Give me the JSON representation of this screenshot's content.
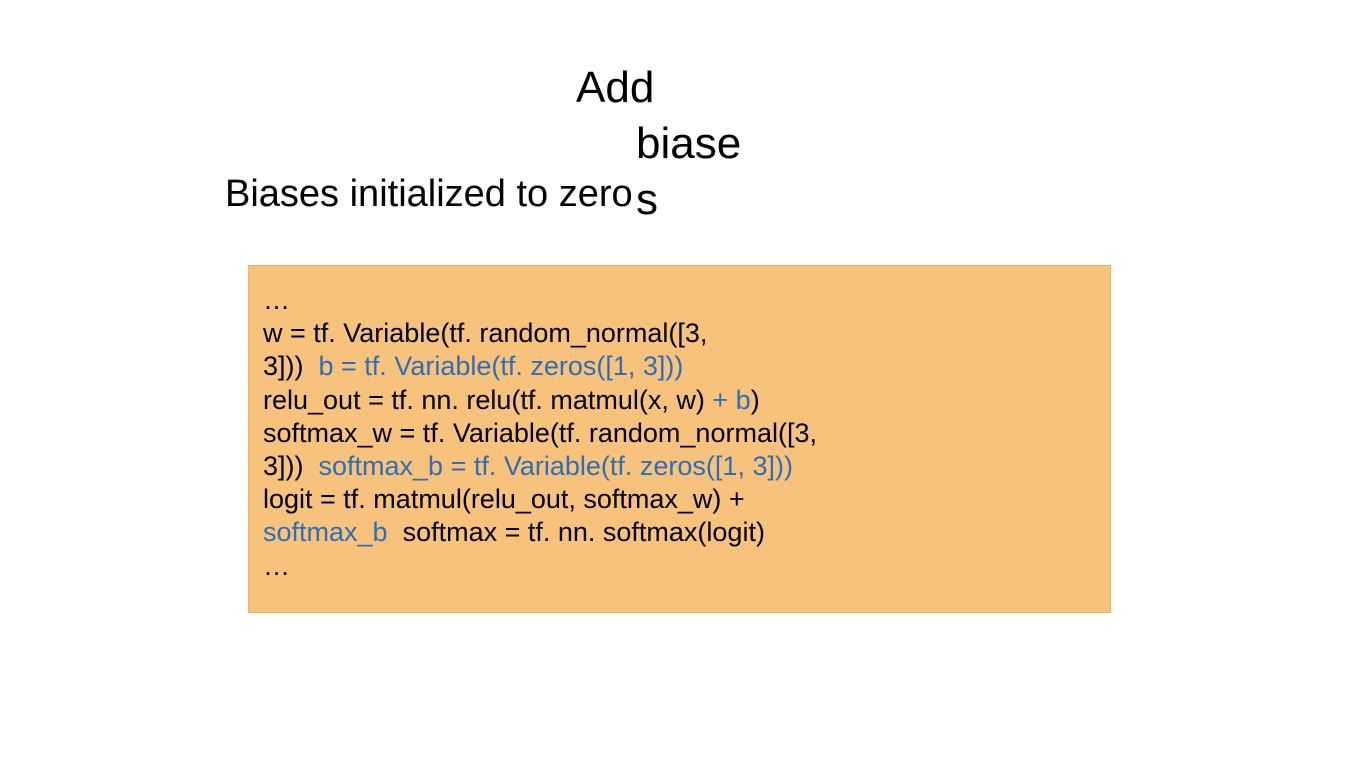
{
  "title": {
    "line1": "Add",
    "line2": "biase",
    "s_overlay": "s"
  },
  "subtitle": "Biases initialized to  zero",
  "code": {
    "l0": "…",
    "l1": "w = tf. Variable(tf. random_normal([3, ",
    "l2_a": "3]))  ",
    "l2_b": "b = tf. Variable(tf. zeros([1, 3]))",
    "l3_a": "relu_out = tf. nn. relu(tf. matmul(x, w)",
    "l3_b": " + b",
    "l3_c": ")",
    "l4": "softmax_w = tf. Variable(tf. random_normal([3, ",
    "l5_a": "3]))  ",
    "l5_b": "softmax_b = tf. Variable(tf. zeros([1, 3]))",
    "l6": "logit = tf. matmul(relu_out, softmax_w) + ",
    "l7_a": "softmax_b",
    "l7_b": "  softmax = tf. nn. softmax(logit)",
    "l8": "…"
  }
}
